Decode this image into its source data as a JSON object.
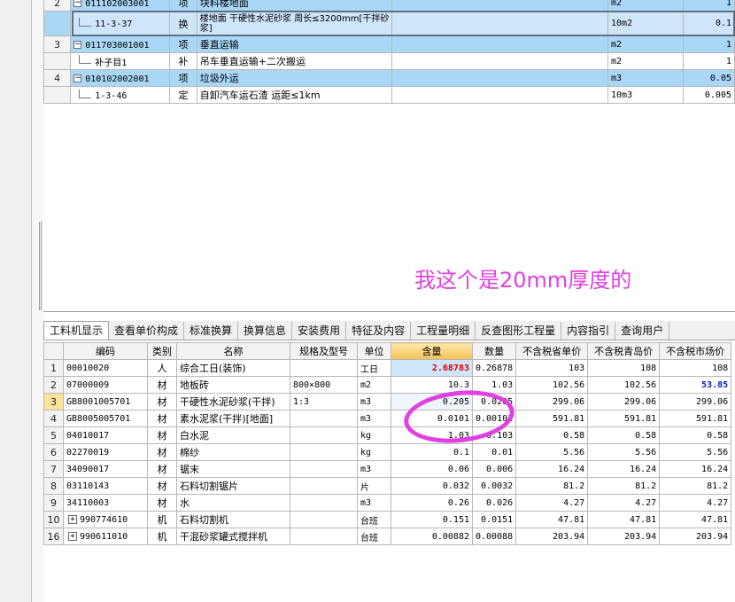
{
  "top_rows": [
    {
      "no": "2",
      "code": "011102003001",
      "type": "项",
      "name": "块料楼地面",
      "unit": "m2",
      "qty": "1",
      "style": "blue",
      "tree": "minus"
    },
    {
      "no": "",
      "code": "11-3-37",
      "type": "换",
      "name": "楼地面 干硬性水泥砂浆 周长≤3200mm[干拌砂浆]",
      "unit": "10m2",
      "qty": "0.1",
      "style": "sel",
      "tree": "line"
    },
    {
      "no": "3",
      "code": "011703001001",
      "type": "项",
      "name": "垂直运输",
      "unit": "m2",
      "qty": "1",
      "style": "blue",
      "tree": "minus"
    },
    {
      "no": "",
      "code": "补子目1",
      "type": "补",
      "name": "吊车垂直运输+二次搬运",
      "unit": "m2",
      "qty": "1",
      "style": "white",
      "tree": "line"
    },
    {
      "no": "4",
      "code": "010102002001",
      "type": "项",
      "name": "垃圾外运",
      "unit": "m3",
      "qty": "0.05",
      "style": "blue",
      "tree": "minus"
    },
    {
      "no": "",
      "code": "1-3-46",
      "type": "定",
      "name": "自卸汽车运石渣 运距≤1km",
      "unit": "10m3",
      "qty": "0.005",
      "style": "white",
      "tree": "line"
    }
  ],
  "note": "我这个是20mm厚度的",
  "tabs": [
    "工料机显示",
    "查看单价构成",
    "标准换算",
    "换算信息",
    "安装费用",
    "特征及内容",
    "工程量明细",
    "反查图形工程量",
    "内容指引",
    "查询用户"
  ],
  "headers": [
    "",
    "编码",
    "类别",
    "名称",
    "规格及型号",
    "单位",
    "含量",
    "数量",
    "不含税省单价",
    "不含税青岛价",
    "不含税市场价"
  ],
  "materials": [
    {
      "no": "1",
      "code": "00010020",
      "cat": "人",
      "name": "综合工日(装饰)",
      "spec": "",
      "unit": "工日",
      "content": "2.68783",
      "qty": "0.26878",
      "p1": "103",
      "p2": "108",
      "p3": "108",
      "expand": false
    },
    {
      "no": "2",
      "code": "07000009",
      "cat": "材",
      "name": "地板砖",
      "spec": "800×800",
      "unit": "m2",
      "content": "10.3",
      "qty": "1.03",
      "p1": "102.56",
      "p2": "102.56",
      "p3": "53.85",
      "expand": false
    },
    {
      "no": "3",
      "code": "GB8001005701",
      "cat": "材",
      "name": "干硬性水泥砂浆(干拌)",
      "spec": "1:3",
      "unit": "m3",
      "content": "0.205",
      "qty": "0.0205",
      "p1": "299.06",
      "p2": "299.06",
      "p3": "299.06",
      "expand": false
    },
    {
      "no": "4",
      "code": "GB8005005701",
      "cat": "材",
      "name": "素水泥浆(干拌)[地面]",
      "spec": "",
      "unit": "m3",
      "content": "0.0101",
      "qty": "0.00101",
      "p1": "591.81",
      "p2": "591.81",
      "p3": "591.81",
      "expand": false
    },
    {
      "no": "5",
      "code": "04010017",
      "cat": "材",
      "name": "白水泥",
      "spec": "",
      "unit": "kg",
      "content": "1.03",
      "qty": "0.103",
      "p1": "0.58",
      "p2": "0.58",
      "p3": "0.58",
      "expand": false
    },
    {
      "no": "6",
      "code": "02270019",
      "cat": "材",
      "name": "棉纱",
      "spec": "",
      "unit": "kg",
      "content": "0.1",
      "qty": "0.01",
      "p1": "5.56",
      "p2": "5.56",
      "p3": "5.56",
      "expand": false
    },
    {
      "no": "7",
      "code": "34090017",
      "cat": "材",
      "name": "锯末",
      "spec": "",
      "unit": "m3",
      "content": "0.06",
      "qty": "0.006",
      "p1": "16.24",
      "p2": "16.24",
      "p3": "16.24",
      "expand": false
    },
    {
      "no": "8",
      "code": "03110143",
      "cat": "材",
      "name": "石料切割锯片",
      "spec": "",
      "unit": "片",
      "content": "0.032",
      "qty": "0.0032",
      "p1": "81.2",
      "p2": "81.2",
      "p3": "81.2",
      "expand": false
    },
    {
      "no": "9",
      "code": "34110003",
      "cat": "材",
      "name": "水",
      "spec": "",
      "unit": "m3",
      "content": "0.26",
      "qty": "0.026",
      "p1": "4.27",
      "p2": "4.27",
      "p3": "4.27",
      "expand": false
    },
    {
      "no": "10",
      "code": "990774610",
      "cat": "机",
      "name": "石料切割机",
      "spec": "",
      "unit": "台班",
      "content": "0.151",
      "qty": "0.0151",
      "p1": "47.81",
      "p2": "47.81",
      "p3": "47.81",
      "expand": true
    },
    {
      "no": "16",
      "code": "990611010",
      "cat": "机",
      "name": "干混砂浆罐式搅拌机",
      "spec": "",
      "unit": "台班",
      "content": "0.00882",
      "qty": "0.00088",
      "p1": "203.94",
      "p2": "203.94",
      "p3": "203.94",
      "expand": true
    }
  ],
  "colors": {
    "row_blue": "#a9d7f5",
    "row_selected": "#cfe5fa",
    "annotation": "#e040e0",
    "value_red": "#e00000",
    "value_blue": "#0018c0"
  }
}
